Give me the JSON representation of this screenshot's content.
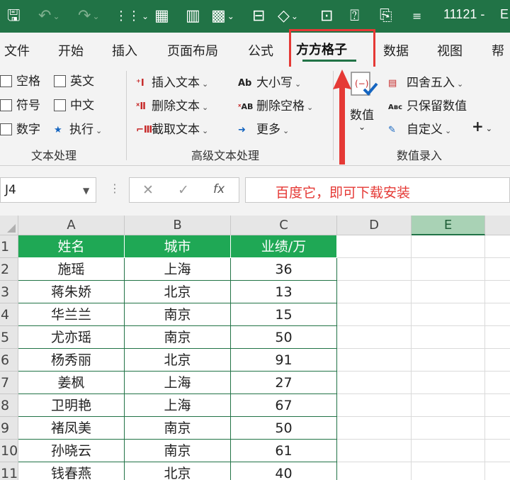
{
  "title_bar": {
    "doc_title": "11121 -",
    "doc_title_cut": "E",
    "quick_access": [
      "save-icon",
      "undo-icon",
      "redo-icon",
      "dotted-grid-icon",
      "calculator-icon",
      "bar-chart-icon",
      "grid-insert-icon",
      "object-icon",
      "shapes-icon",
      "text-box-icon",
      "help-icon",
      "clipboard-icon",
      "customize-icon"
    ]
  },
  "tabs": [
    "文件",
    "开始",
    "插入",
    "页面布局",
    "公式",
    "方方格子",
    "数据",
    "视图",
    "帮"
  ],
  "active_tab": "方方格子",
  "ribbon": {
    "text_processing": {
      "checkboxes": [
        "空格",
        "英文",
        "符号",
        "中文",
        "数字"
      ],
      "execute": "执行",
      "group_label": "文本处理"
    },
    "advanced_text": {
      "items": [
        "插入文本",
        "删除文本",
        "截取文本",
        "大小写",
        "删除空格",
        "更多"
      ],
      "group_label": "高级文本处理"
    },
    "numeric": {
      "big_button": "数值",
      "items": [
        "四舍五入",
        "只保留数值",
        "自定义"
      ],
      "plus": "+",
      "group_label": "数值录入"
    }
  },
  "formula_bar": {
    "name_box": "J4",
    "fx": "fx",
    "content": "百度它，即可下载安装"
  },
  "columns": [
    "A",
    "B",
    "C",
    "D",
    "E"
  ],
  "selected_column": "E",
  "rows": [
    "1",
    "2",
    "3",
    "4",
    "5",
    "6",
    "7",
    "8",
    "9",
    "10",
    "11"
  ],
  "table": {
    "headers": [
      "姓名",
      "城市",
      "业绩/万"
    ],
    "data": [
      [
        "施瑶",
        "上海",
        "36"
      ],
      [
        "蒋朱娇",
        "北京",
        "13"
      ],
      [
        "华兰兰",
        "南京",
        "15"
      ],
      [
        "尤亦瑶",
        "南京",
        "50"
      ],
      [
        "杨秀丽",
        "北京",
        "91"
      ],
      [
        "姜枫",
        "上海",
        "27"
      ],
      [
        "卫明艳",
        "上海",
        "67"
      ],
      [
        "褚凤美",
        "南京",
        "50"
      ],
      [
        "孙晓云",
        "南京",
        "61"
      ],
      [
        "钱春燕",
        "北京",
        "40"
      ]
    ]
  },
  "colors": {
    "excel_green": "#217346",
    "header_fill": "#1fa855",
    "highlight_red": "#e53935"
  }
}
